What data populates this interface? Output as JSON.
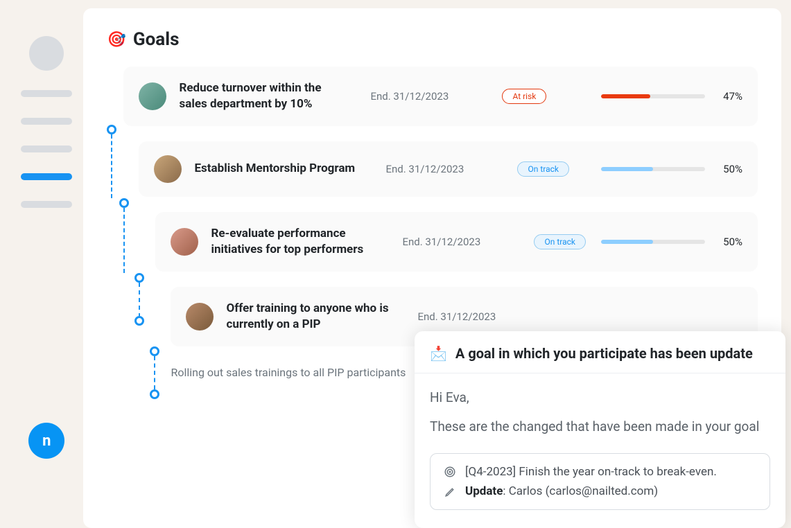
{
  "sidebar": {
    "logo_letter": "n"
  },
  "header": {
    "icon": "🎯",
    "title": "Goals"
  },
  "goals": [
    {
      "title": "Reduce turnover within the sales department by 10%",
      "end": "End. 31/12/2023",
      "status_label": "At risk",
      "status_kind": "risk",
      "progress_pct": "47%",
      "progress_val": 47
    },
    {
      "title": "Establish Mentorship Program",
      "end": "End. 31/12/2023",
      "status_label": "On track",
      "status_kind": "ontrack",
      "progress_pct": "50%",
      "progress_val": 50
    },
    {
      "title": "Re-evaluate performance initiatives for top performers",
      "end": "End. 31/12/2023",
      "status_label": "On track",
      "status_kind": "ontrack",
      "progress_pct": "50%",
      "progress_val": 50
    },
    {
      "title": "Offer training to anyone who is currently on a PIP",
      "end": "End. 31/12/2023"
    }
  ],
  "rolling_text": "Rolling out sales trainings to all PIP participants",
  "notification": {
    "header": "A goal in which you participate has been update",
    "greeting": "Hi Eva,",
    "body": "These are the changed that have been made in your goal",
    "box_goal": "[Q4-2023] Finish the year on-track to break-even.",
    "box_update_label": "Update",
    "box_update_value": ": Carlos (carlos@nailted.com)"
  }
}
